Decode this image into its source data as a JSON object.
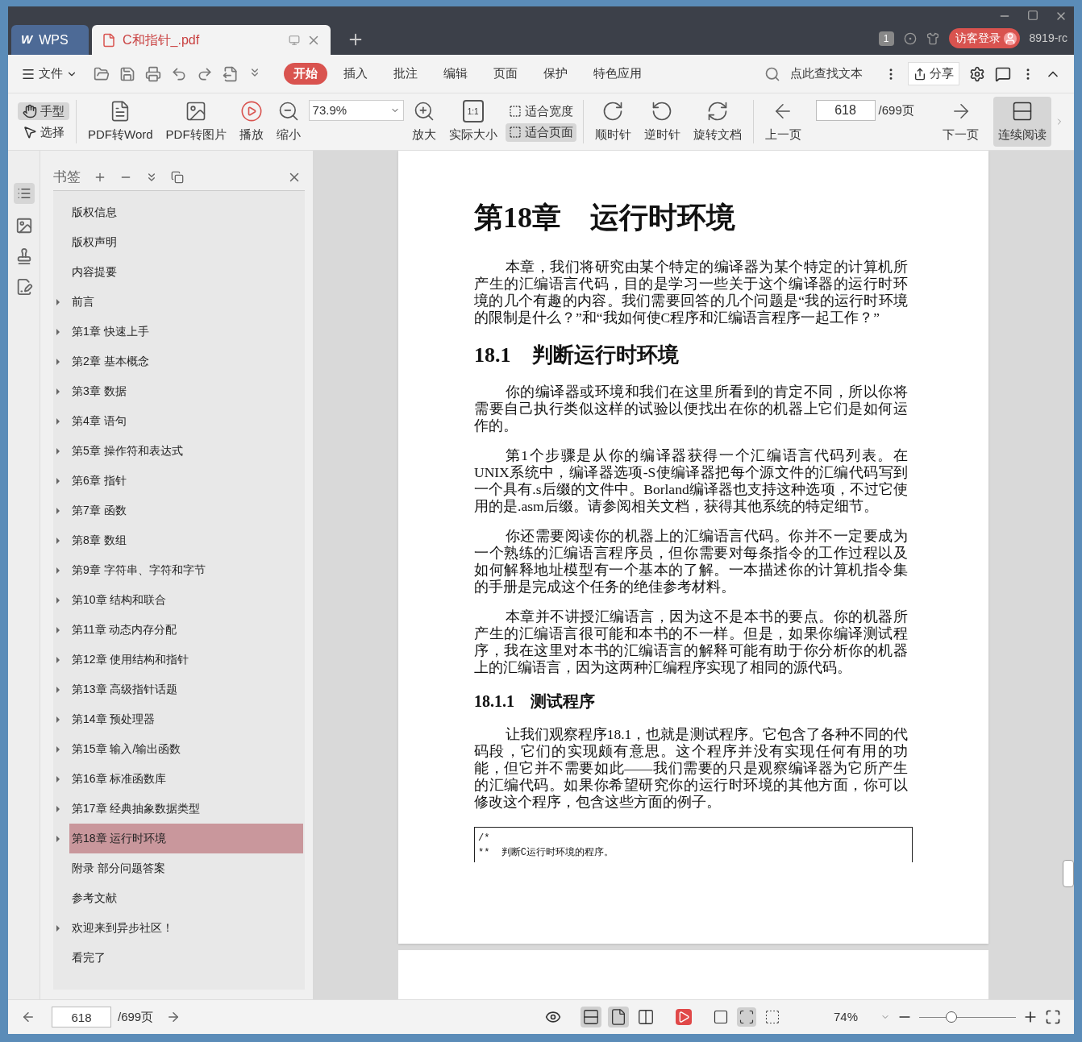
{
  "tabs": [
    {
      "label": "WPS",
      "kind": "home",
      "logo": "W",
      "selected": false
    },
    {
      "label": "C和指针_.pdf",
      "kind": "file",
      "selected": true
    }
  ],
  "title_bar": {
    "badge": "1",
    "login": "访客登录",
    "user": "8919-rc"
  },
  "menu": {
    "file": "文件",
    "ribbon_tabs": [
      {
        "label": "开始",
        "selected": true
      },
      {
        "label": "插入",
        "selected": false
      },
      {
        "label": "批注",
        "selected": false
      },
      {
        "label": "编辑",
        "selected": false
      },
      {
        "label": "页面",
        "selected": false
      },
      {
        "label": "保护",
        "selected": false
      },
      {
        "label": "特色应用",
        "selected": false
      }
    ],
    "search_placeholder": "点此查找文本",
    "share": "分享"
  },
  "toolbar": {
    "modes": [
      {
        "label": "手型",
        "kind": "hand",
        "selected": true
      },
      {
        "label": "选择",
        "kind": "select",
        "selected": false
      }
    ],
    "convert": [
      {
        "label": "PDF转Word",
        "kind": "word"
      },
      {
        "label": "PDF转图片",
        "kind": "image"
      },
      {
        "label": "播放",
        "kind": "play"
      },
      {
        "label": "缩小",
        "kind": "zoom-out"
      }
    ],
    "zoom": "73.9%",
    "zoom_tools": [
      {
        "label": "放大",
        "kind": "zoom-in"
      },
      {
        "label": "实际大小",
        "kind": "actual",
        "icon_text": "1:1"
      }
    ],
    "fit": [
      {
        "label": "适合宽度",
        "selected": false
      },
      {
        "label": "适合页面",
        "selected": true
      }
    ],
    "rotate": [
      {
        "label": "顺时针",
        "kind": "cw"
      },
      {
        "label": "逆时针",
        "kind": "ccw"
      },
      {
        "label": "旋转文档",
        "kind": "rotate-doc"
      }
    ],
    "prev": "上一页",
    "page": "618",
    "total": "/699页",
    "next": "下一页",
    "continuous": {
      "label": "连续阅读",
      "selected": true
    }
  },
  "bookmarks": {
    "title": "书签",
    "items": [
      {
        "label": "版权信息",
        "has_children": false,
        "selected": false
      },
      {
        "label": "版权声明",
        "has_children": false,
        "selected": false
      },
      {
        "label": "内容提要",
        "has_children": false,
        "selected": false
      },
      {
        "label": "前言",
        "has_children": true,
        "selected": false
      },
      {
        "label": "第1章 快速上手",
        "has_children": true,
        "selected": false
      },
      {
        "label": "第2章 基本概念",
        "has_children": true,
        "selected": false
      },
      {
        "label": "第3章 数据",
        "has_children": true,
        "selected": false
      },
      {
        "label": "第4章 语句",
        "has_children": true,
        "selected": false
      },
      {
        "label": "第5章 操作符和表达式",
        "has_children": true,
        "selected": false
      },
      {
        "label": "第6章 指针",
        "has_children": true,
        "selected": false
      },
      {
        "label": "第7章 函数",
        "has_children": true,
        "selected": false
      },
      {
        "label": "第8章 数组",
        "has_children": true,
        "selected": false
      },
      {
        "label": "第9章 字符串、字符和字节",
        "has_children": true,
        "selected": false
      },
      {
        "label": "第10章 结构和联合",
        "has_children": true,
        "selected": false
      },
      {
        "label": "第11章 动态内存分配",
        "has_children": true,
        "selected": false
      },
      {
        "label": "第12章 使用结构和指针",
        "has_children": true,
        "selected": false
      },
      {
        "label": "第13章 高级指针话题",
        "has_children": true,
        "selected": false
      },
      {
        "label": "第14章 预处理器",
        "has_children": true,
        "selected": false
      },
      {
        "label": "第15章 输入/输出函数",
        "has_children": true,
        "selected": false
      },
      {
        "label": "第16章 标准函数库",
        "has_children": true,
        "selected": false
      },
      {
        "label": "第17章 经典抽象数据类型",
        "has_children": true,
        "selected": false
      },
      {
        "label": "第18章 运行时环境",
        "has_children": true,
        "selected": true
      },
      {
        "label": "附录 部分问题答案",
        "has_children": false,
        "selected": false
      },
      {
        "label": "参考文献",
        "has_children": false,
        "selected": false
      },
      {
        "label": "欢迎来到异步社区！",
        "has_children": true,
        "selected": false
      },
      {
        "label": "看完了",
        "has_children": false,
        "selected": false
      }
    ]
  },
  "document": [
    {
      "kind": "chapter",
      "text": "第18章　运行时环境"
    },
    {
      "kind": "para",
      "text": "本章，我们将研究由某个特定的编译器为某个特定的计算机所产生的汇编语言代码，目的是学习一些关于这个编译器的运行时环境的几个有趣的内容。我们需要回答的几个问题是“我的运行时环境的限制是什么？”和“我如何使C程序和汇编语言程序一起工作？”"
    },
    {
      "kind": "section",
      "text": "18.1　判断运行时环境"
    },
    {
      "kind": "para",
      "text": "你的编译器或环境和我们在这里所看到的肯定不同，所以你将需要自己执行类似这样的试验以便找出在你的机器上它们是如何运作的。"
    },
    {
      "kind": "para",
      "text": "第1个步骤是从你的编译器获得一个汇编语言代码列表。在UNIX系统中，编译器选项-S使编译器把每个源文件的汇编代码写到一个具有.s后缀的文件中。Borland编译器也支持这种选项，不过它使用的是.asm后缀。请参阅相关文档，获得其他系统的特定细节。"
    },
    {
      "kind": "para",
      "text": "你还需要阅读你的机器上的汇编语言代码。你并不一定要成为一个熟练的汇编语言程序员，但你需要对每条指令的工作过程以及如何解释地址模型有一个基本的了解。一本描述你的计算机指令集的手册是完成这个任务的绝佳参考材料。"
    },
    {
      "kind": "para",
      "text": "本章并不讲授汇编语言，因为这不是本书的要点。你的机器所产生的汇编语言很可能和本书的不一样。但是，如果你编译测试程序，我在这里对本书的汇编语言的解释可能有助于你分析你的机器上的汇编语言，因为这两种汇编程序实现了相同的源代码。"
    },
    {
      "kind": "subsection",
      "text": "18.1.1　测试程序"
    },
    {
      "kind": "para",
      "text": "让我们观察程序18.1，也就是测试程序。它包含了各种不同的代码段，它们的实现颇有意思。这个程序并没有实现任何有用的功能，但它并不需要如此——我们需要的只是观察编译器为它所产生的汇编代码。如果你希望研究你的运行时环境的其他方面，你可以修改这个程序，包含这些方面的例子。"
    },
    {
      "kind": "code",
      "lines": [
        "/*",
        "**  判断C运行时环境的程序。"
      ]
    }
  ],
  "status_bar": {
    "page": "618",
    "total": "/699页",
    "view_modes": [
      {
        "kind": "continuous",
        "selected": true
      },
      {
        "kind": "single",
        "selected": true
      },
      {
        "kind": "double",
        "selected": false
      }
    ],
    "fit_modes": [
      {
        "kind": "actual",
        "selected": false
      },
      {
        "kind": "fit-page",
        "selected": true
      },
      {
        "kind": "fit-width",
        "selected": false
      }
    ],
    "zoom": "74%",
    "zoom_slider": {
      "level": 0.33
    }
  }
}
